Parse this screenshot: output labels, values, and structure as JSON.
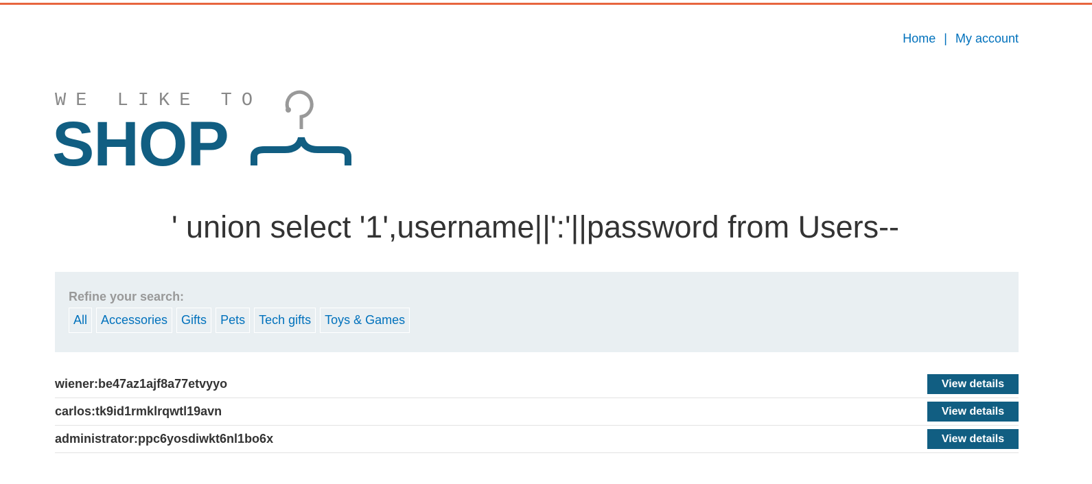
{
  "nav": {
    "home": "Home",
    "separator": "|",
    "account": "My account"
  },
  "logo": {
    "small": "WE LIKE TO",
    "big": "SHOP"
  },
  "search_title": "' union select '1',username||':'||password from Users--",
  "filter": {
    "label": "Refine your search:",
    "categories": [
      "All",
      "Accessories",
      "Gifts",
      "Pets",
      "Tech gifts",
      "Toys & Games"
    ]
  },
  "results": [
    {
      "text": "wiener:be47az1ajf8a77etvyyo",
      "button": "View details"
    },
    {
      "text": "carlos:tk9id1rmklrqwtl19avn",
      "button": "View details"
    },
    {
      "text": "administrator:ppc6yosdiwkt6nl1bo6x",
      "button": "View details"
    }
  ],
  "colors": {
    "accent": "#115e82",
    "link": "#0071bc",
    "topbar": "#e8653f"
  }
}
